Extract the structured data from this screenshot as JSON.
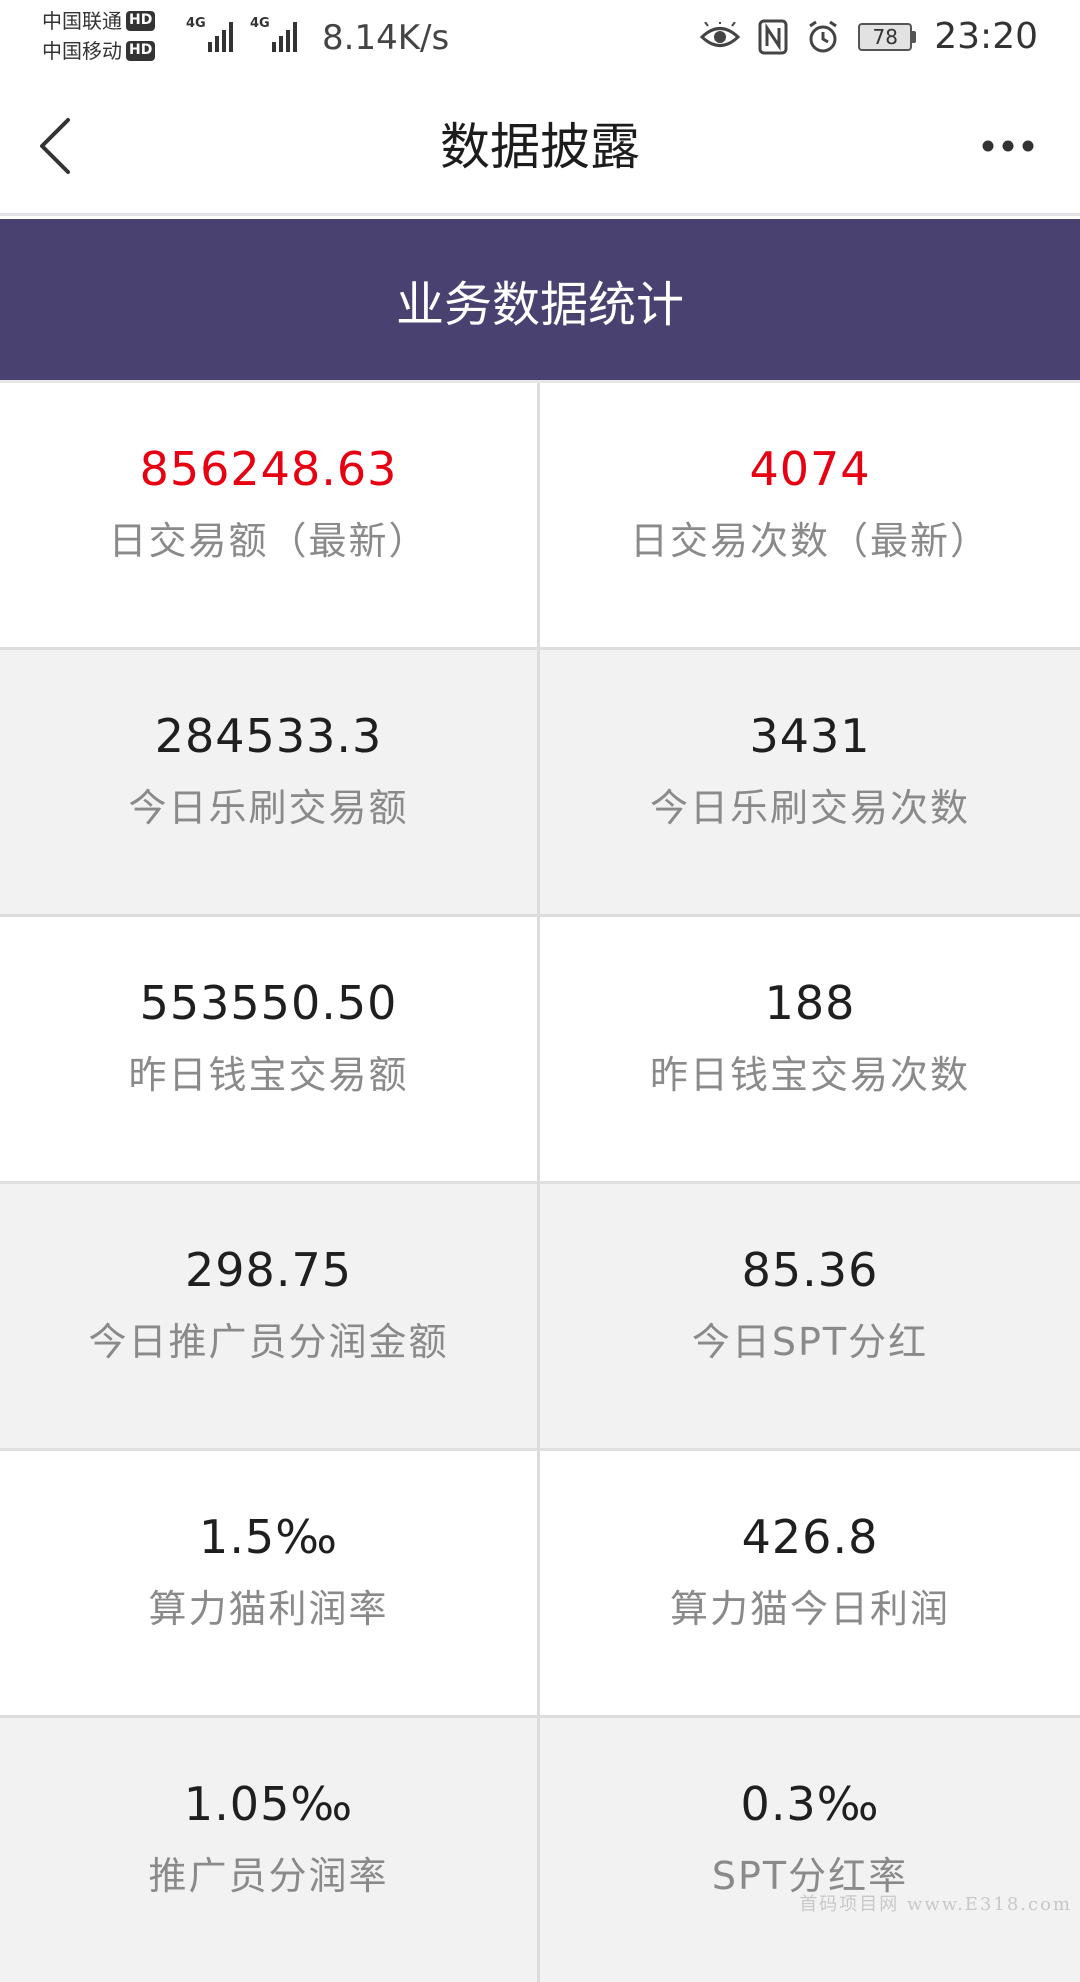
{
  "status_bar": {
    "carrier_1": "中国联通",
    "carrier_2": "中国移动",
    "hd_label": "HD",
    "network_type": "4G",
    "net_speed": "8.14K/s",
    "battery_level": "78",
    "time": "23:20",
    "icons": [
      "eye-icon",
      "nfc-icon",
      "alarm-icon",
      "battery-icon"
    ]
  },
  "header": {
    "title": "数据披露",
    "back_icon": "chevron-left-icon",
    "more_icon": "more-dots-icon"
  },
  "section": {
    "title": "业务数据统计",
    "background_color": "#494270"
  },
  "highlight_color": "#e60012",
  "stats": [
    {
      "left": {
        "value": "856248.63",
        "label": "日交易额（最新）"
      },
      "right": {
        "value": "4074",
        "label": "日交易次数（最新）"
      }
    },
    {
      "left": {
        "value": "284533.3",
        "label": "今日乐刷交易额"
      },
      "right": {
        "value": "3431",
        "label": "今日乐刷交易次数"
      }
    },
    {
      "left": {
        "value": "553550.50",
        "label": "昨日钱宝交易额"
      },
      "right": {
        "value": "188",
        "label": "昨日钱宝交易次数"
      }
    },
    {
      "left": {
        "value": "298.75",
        "label": "今日推广员分润金额"
      },
      "right": {
        "value": "85.36",
        "label": "今日SPT分红"
      }
    },
    {
      "left": {
        "value": "1.5‰",
        "label": "算力猫利润率"
      },
      "right": {
        "value": "426.8",
        "label": "算力猫今日利润"
      }
    },
    {
      "left": {
        "value": "1.05‰",
        "label": "推广员分润率"
      },
      "right": {
        "value": "0.3‰",
        "label": "SPT分红率"
      }
    }
  ],
  "watermark": "首码项目网 www.E318.com"
}
